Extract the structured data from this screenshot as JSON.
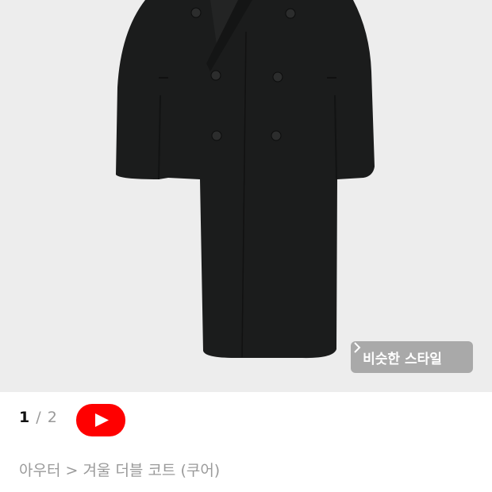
{
  "product_image": {
    "alt_icon": "black-double-breasted-coat-photo",
    "background_color": "#ededed",
    "coat_color": "#1b1c1c"
  },
  "similar_style": {
    "label": "비슷한 스타일",
    "icon": "chevron-right-icon"
  },
  "pager": {
    "current": "1",
    "separator": "/",
    "total": "2"
  },
  "video_button": {
    "icon": "youtube-play-icon",
    "color": "#ff0000"
  },
  "breadcrumb": {
    "text": "아우터 > 겨울 더블 코트 (쿠어)"
  }
}
